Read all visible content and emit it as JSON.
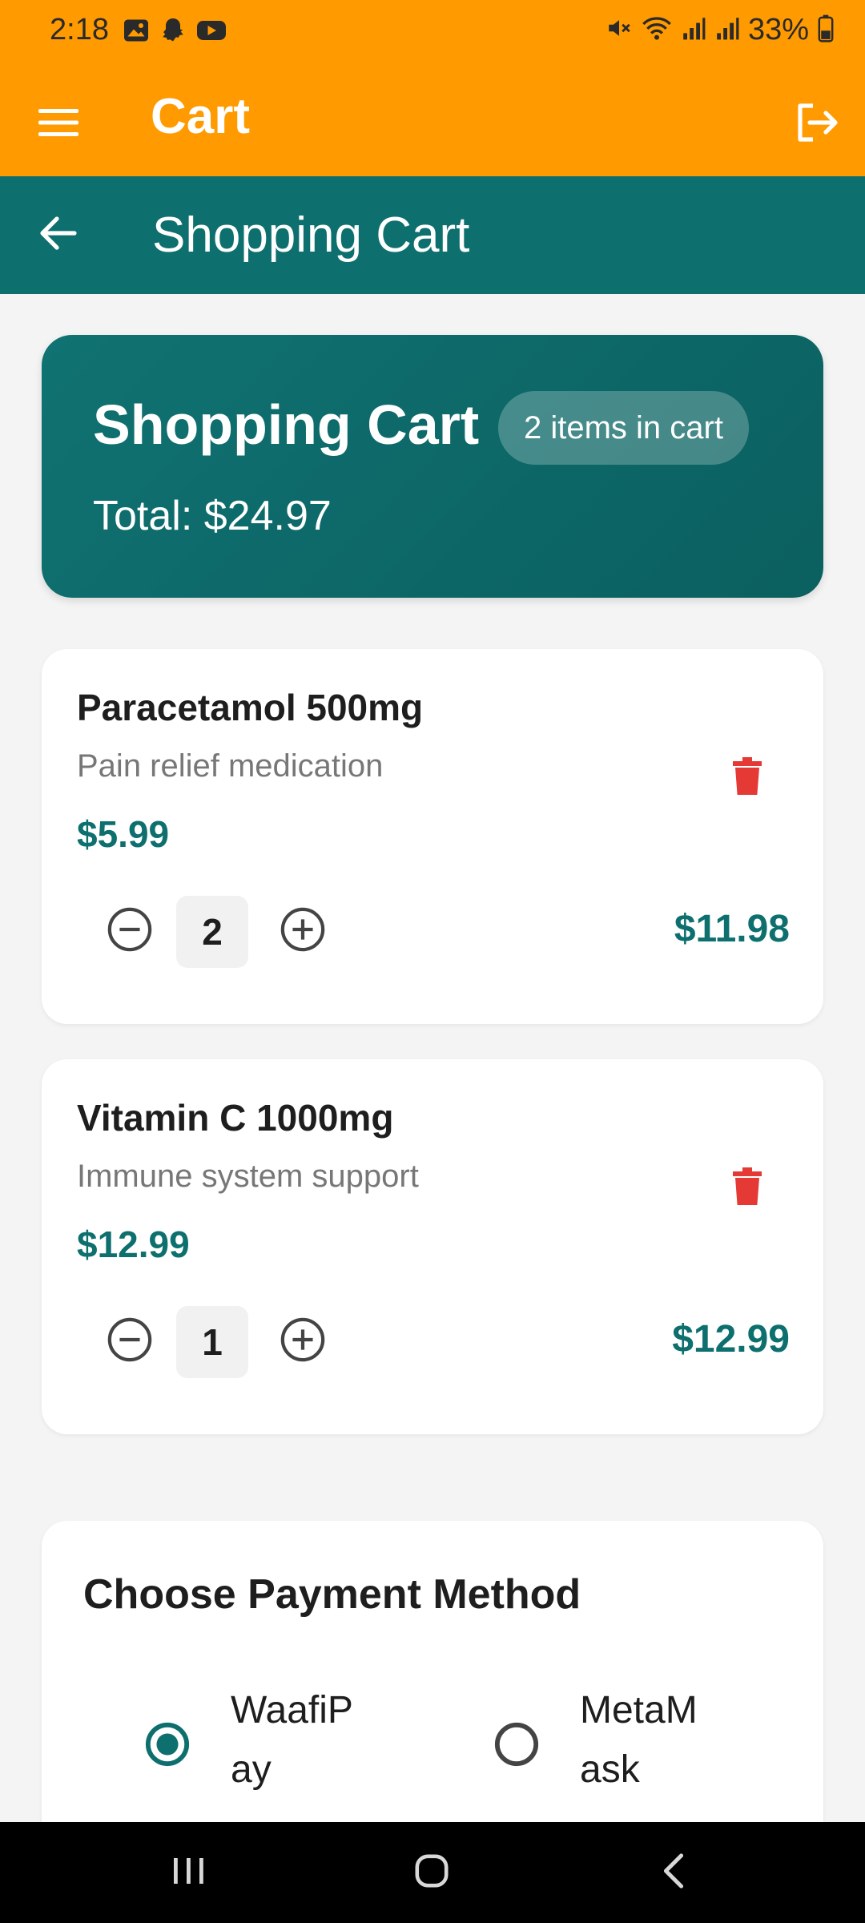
{
  "status_bar": {
    "time": "2:18",
    "left_icons": [
      "gallery-icon",
      "snapchat-icon",
      "youtube-icon"
    ],
    "right_icons": [
      "mute-icon",
      "wifi-icon",
      "signal-icon",
      "signal-icon",
      "battery-charging-icon"
    ],
    "battery": "33%"
  },
  "app_bar": {
    "title": "Cart",
    "menu_icon": "hamburger-menu-icon",
    "logout_icon": "logout-icon",
    "color": "#ff9a00"
  },
  "sub_header": {
    "title": "Shopping Cart",
    "back_icon": "arrow-back-icon",
    "color": "#0e6f6f"
  },
  "summary": {
    "title": "Shopping Cart",
    "badge": "2 items in cart",
    "total": "Total: $24.97"
  },
  "cart_items": [
    {
      "name": "Paracetamol 500mg",
      "description": "Pain relief medication",
      "price": "$5.99",
      "quantity": "2",
      "subtotal": "$11.98"
    },
    {
      "name": "Vitamin C 1000mg",
      "description": "Immune system support",
      "price": "$12.99",
      "quantity": "1",
      "subtotal": "$12.99"
    }
  ],
  "payment": {
    "title": "Choose Payment Method",
    "options": [
      {
        "label": "WaafiPay",
        "selected": true
      },
      {
        "label": "MetaMask",
        "selected": false
      }
    ]
  },
  "colors": {
    "accent": "#0e6f6f",
    "danger": "#e53935",
    "background": "#f4f4f4"
  }
}
